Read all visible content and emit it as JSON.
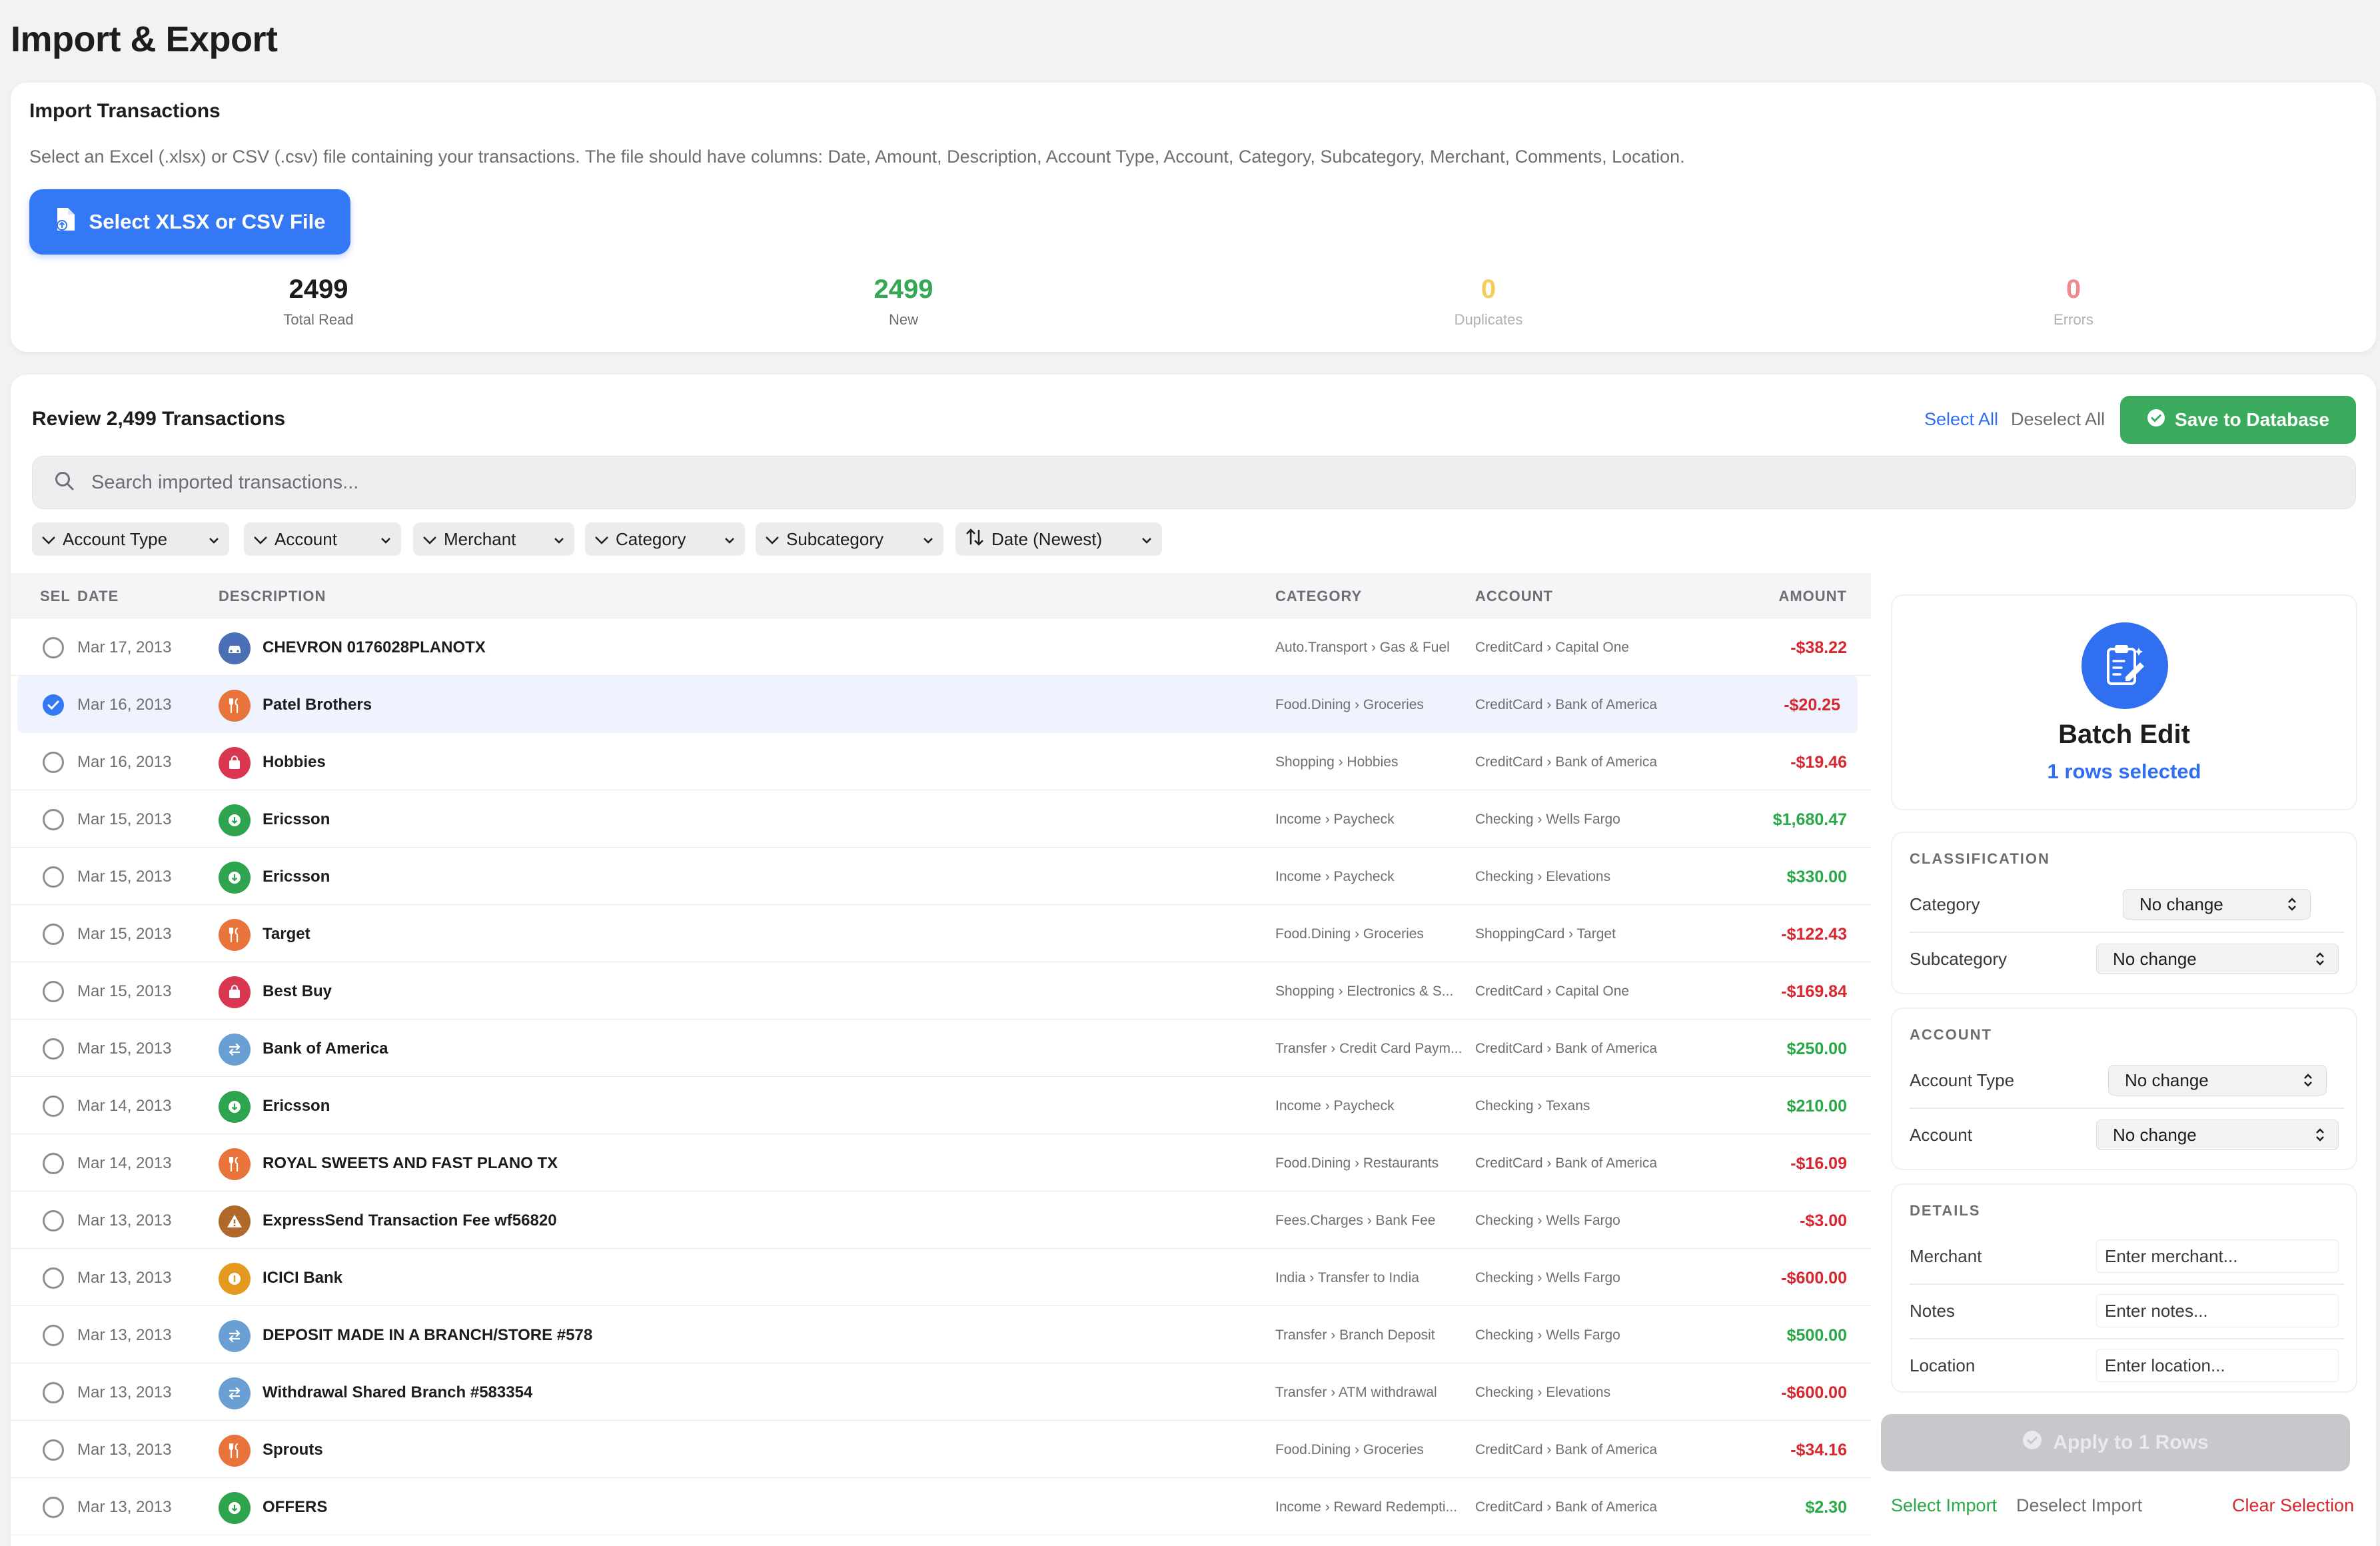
{
  "page": {
    "title": "Import & Export"
  },
  "import": {
    "title": "Import Transactions",
    "description": "Select an Excel (.xlsx) or CSV (.csv) file containing your transactions. The file should have columns: Date, Amount, Description, Account Type, Account, Category, Subcategory, Merchant, Comments, Location.",
    "select_button": "Select XLSX or CSV File",
    "stats": {
      "total": {
        "value": "2499",
        "label": "Total Read",
        "color": "#1d1d1f"
      },
      "new": {
        "value": "2499",
        "label": "New",
        "color": "#34a853"
      },
      "duplicates": {
        "value": "0",
        "label": "Duplicates",
        "color": "#f5cd5a"
      },
      "errors": {
        "value": "0",
        "label": "Errors",
        "color": "#ee8a8e"
      }
    }
  },
  "review": {
    "title": "Review 2,499 Transactions",
    "select_all": "Select All",
    "deselect_all": "Deselect All",
    "save_button": "Save to Database",
    "search_placeholder": "Search imported transactions...",
    "filters": [
      "Account Type",
      "Account",
      "Merchant",
      "Category",
      "Subcategory",
      "Date (Newest)"
    ],
    "columns": {
      "sel": "SEL",
      "date": "DATE",
      "description": "DESCRIPTION",
      "category": "CATEGORY",
      "account": "ACCOUNT",
      "amount": "AMOUNT"
    },
    "rows": [
      {
        "date": "Mar 17, 2013",
        "description": "CHEVRON 0176028PLANOTX",
        "category": "Auto.Transport › Gas & Fuel",
        "account": "CreditCard › Capital One",
        "amount": "-$38.22",
        "sign": "neg",
        "icon": "car-icon",
        "icon_color": "#4a6fb5",
        "selected": false
      },
      {
        "date": "Mar 16, 2013",
        "description": "Patel Brothers",
        "category": "Food.Dining › Groceries",
        "account": "CreditCard › Bank of America",
        "amount": "-$20.25",
        "sign": "neg",
        "icon": "fork-knife-icon",
        "icon_color": "#e8743b",
        "selected": true
      },
      {
        "date": "Mar 16, 2013",
        "description": "Hobbies",
        "category": "Shopping › Hobbies",
        "account": "CreditCard › Bank of America",
        "amount": "-$19.46",
        "sign": "neg",
        "icon": "shopping-bag-icon",
        "icon_color": "#d9364f",
        "selected": false
      },
      {
        "date": "Mar 15, 2013",
        "description": "Ericsson",
        "category": "Income › Paycheck",
        "account": "Checking › Wells Fargo",
        "amount": "$1,680.47",
        "sign": "pos",
        "icon": "income-icon",
        "icon_color": "#2ea44f",
        "selected": false
      },
      {
        "date": "Mar 15, 2013",
        "description": "Ericsson",
        "category": "Income › Paycheck",
        "account": "Checking › Elevations",
        "amount": "$330.00",
        "sign": "pos",
        "icon": "income-icon",
        "icon_color": "#2ea44f",
        "selected": false
      },
      {
        "date": "Mar 15, 2013",
        "description": "Target",
        "category": "Food.Dining › Groceries",
        "account": "ShoppingCard › Target",
        "amount": "-$122.43",
        "sign": "neg",
        "icon": "fork-knife-icon",
        "icon_color": "#e8743b",
        "selected": false
      },
      {
        "date": "Mar 15, 2013",
        "description": "Best Buy",
        "category": "Shopping › Electronics & S...",
        "account": "CreditCard › Capital One",
        "amount": "-$169.84",
        "sign": "neg",
        "icon": "shopping-bag-icon",
        "icon_color": "#d9364f",
        "selected": false
      },
      {
        "date": "Mar 15, 2013",
        "description": "Bank of America",
        "category": "Transfer › Credit Card Paym...",
        "account": "CreditCard › Bank of America",
        "amount": "$250.00",
        "sign": "pos",
        "icon": "transfer-icon",
        "icon_color": "#6a9fd4",
        "selected": false
      },
      {
        "date": "Mar 14, 2013",
        "description": "Ericsson",
        "category": "Income › Paycheck",
        "account": "Checking › Texans",
        "amount": "$210.00",
        "sign": "pos",
        "icon": "income-icon",
        "icon_color": "#2ea44f",
        "selected": false
      },
      {
        "date": "Mar 14, 2013",
        "description": "ROYAL SWEETS AND FAST PLANO TX",
        "category": "Food.Dining › Restaurants",
        "account": "CreditCard › Bank of America",
        "amount": "-$16.09",
        "sign": "neg",
        "icon": "fork-knife-icon",
        "icon_color": "#e8743b",
        "selected": false
      },
      {
        "date": "Mar 13, 2013",
        "description": "ExpressSend Transaction Fee wf56820",
        "category": "Fees.Charges › Bank Fee",
        "account": "Checking › Wells Fargo",
        "amount": "-$3.00",
        "sign": "neg",
        "icon": "warning-icon",
        "icon_color": "#b0692a",
        "selected": false
      },
      {
        "date": "Mar 13, 2013",
        "description": "ICICI Bank",
        "category": "India › Transfer to India",
        "account": "Checking › Wells Fargo",
        "amount": "-$600.00",
        "sign": "neg",
        "icon": "coin-icon",
        "icon_color": "#e59a1f",
        "selected": false
      },
      {
        "date": "Mar 13, 2013",
        "description": "DEPOSIT MADE IN A BRANCH/STORE #578",
        "category": "Transfer › Branch Deposit",
        "account": "Checking › Wells Fargo",
        "amount": "$500.00",
        "sign": "pos",
        "icon": "transfer-icon",
        "icon_color": "#6a9fd4",
        "selected": false
      },
      {
        "date": "Mar 13, 2013",
        "description": "Withdrawal Shared Branch #583354",
        "category": "Transfer › ATM withdrawal",
        "account": "Checking › Elevations",
        "amount": "-$600.00",
        "sign": "neg",
        "icon": "transfer-icon",
        "icon_color": "#6a9fd4",
        "selected": false
      },
      {
        "date": "Mar 13, 2013",
        "description": "Sprouts",
        "category": "Food.Dining › Groceries",
        "account": "CreditCard › Bank of America",
        "amount": "-$34.16",
        "sign": "neg",
        "icon": "fork-knife-icon",
        "icon_color": "#e8743b",
        "selected": false
      },
      {
        "date": "Mar 13, 2013",
        "description": "OFFERS",
        "category": "Income › Reward Redempti...",
        "account": "CreditCard › Bank of America",
        "amount": "$2.30",
        "sign": "pos",
        "icon": "income-icon",
        "icon_color": "#2ea44f",
        "selected": false
      }
    ]
  },
  "batch": {
    "title": "Batch Edit",
    "subtitle": "1 rows selected",
    "classification": {
      "title": "CLASSIFICATION",
      "category_label": "Category",
      "category_value": "No change",
      "subcategory_label": "Subcategory",
      "subcategory_value": "No change"
    },
    "account": {
      "title": "ACCOUNT",
      "account_type_label": "Account Type",
      "account_type_value": "No change",
      "account_label": "Account",
      "account_value": "No change"
    },
    "details": {
      "title": "DETAILS",
      "merchant_label": "Merchant",
      "merchant_placeholder": "Enter merchant...",
      "notes_label": "Notes",
      "notes_placeholder": "Enter notes...",
      "location_label": "Location",
      "location_placeholder": "Enter location..."
    },
    "apply_button": "Apply to 1 Rows",
    "select_import": "Select Import",
    "deselect_import": "Deselect Import",
    "clear_selection": "Clear Selection"
  },
  "colors": {
    "accent": "#3478f6",
    "success": "#3aaa5c",
    "danger": "#d8262f"
  }
}
